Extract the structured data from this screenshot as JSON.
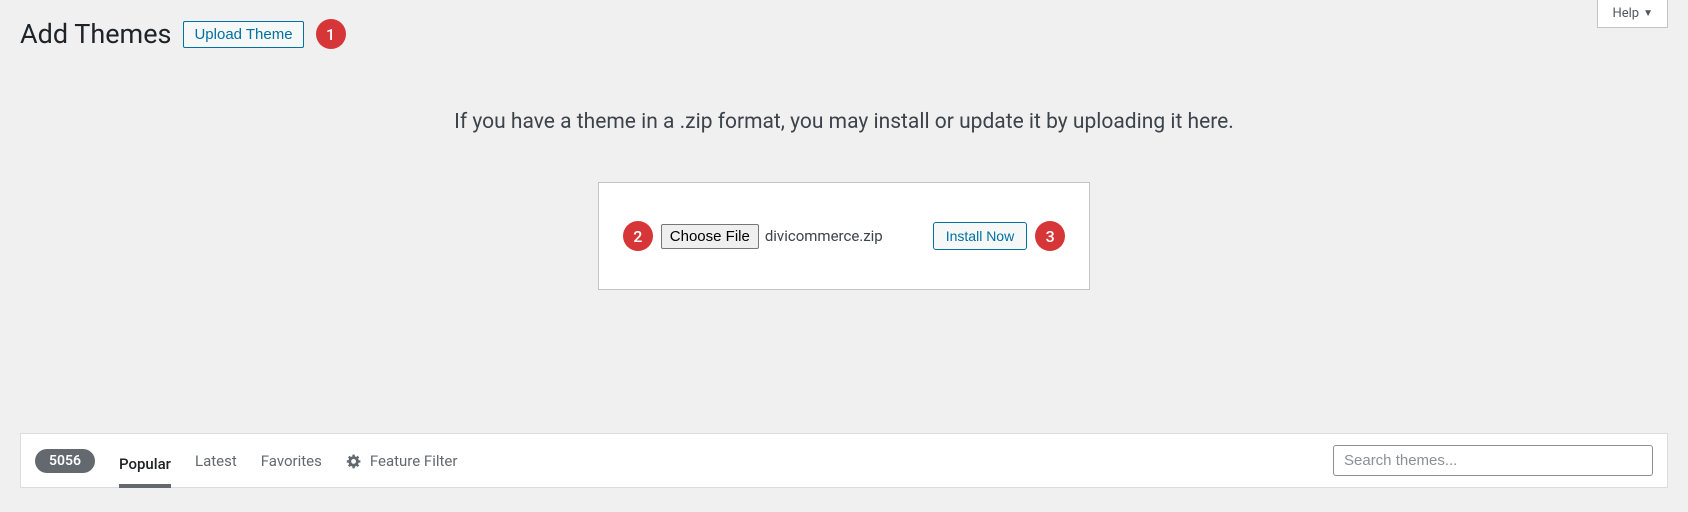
{
  "help_tab": {
    "label": "Help"
  },
  "header": {
    "title": "Add Themes",
    "upload_button": "Upload Theme"
  },
  "annotations": {
    "one": "1",
    "two": "2",
    "three": "3"
  },
  "upload": {
    "instruction": "If you have a theme in a .zip format, you may install or update it by uploading it here.",
    "choose_file_label": "Choose File",
    "selected_file": "divicommerce.zip",
    "install_label": "Install Now"
  },
  "filter_bar": {
    "count": "5056",
    "tabs": {
      "popular": "Popular",
      "latest": "Latest",
      "favorites": "Favorites"
    },
    "feature_filter": "Feature Filter",
    "search_placeholder": "Search themes..."
  }
}
